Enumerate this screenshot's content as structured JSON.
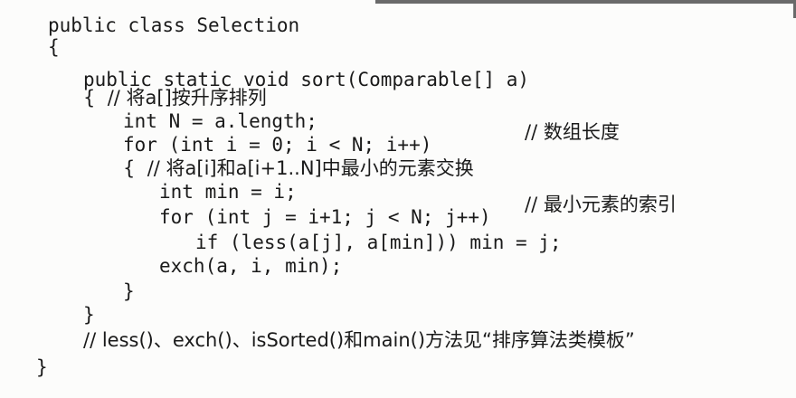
{
  "code": {
    "lines": [
      "public class Selection",
      "{",
      "public static void sort(Comparable[] a)",
      "{  // 将a[]按升序排列",
      "int N = a.length;",
      "// 数组长度",
      "for (int i = 0; i < N; i++)",
      "{  // 将a[i]和a[i+1..N]中最小的元素交换",
      "int min = i;",
      "// 最小元素的索引",
      "for (int j = i+1; j < N; j++)",
      "if (less(a[j], a[min])) min = j;",
      "exch(a, i, min);",
      "}",
      "}",
      "// less()、exch()、isSorted()和main()方法见“排序算法类模板”",
      "}"
    ]
  }
}
